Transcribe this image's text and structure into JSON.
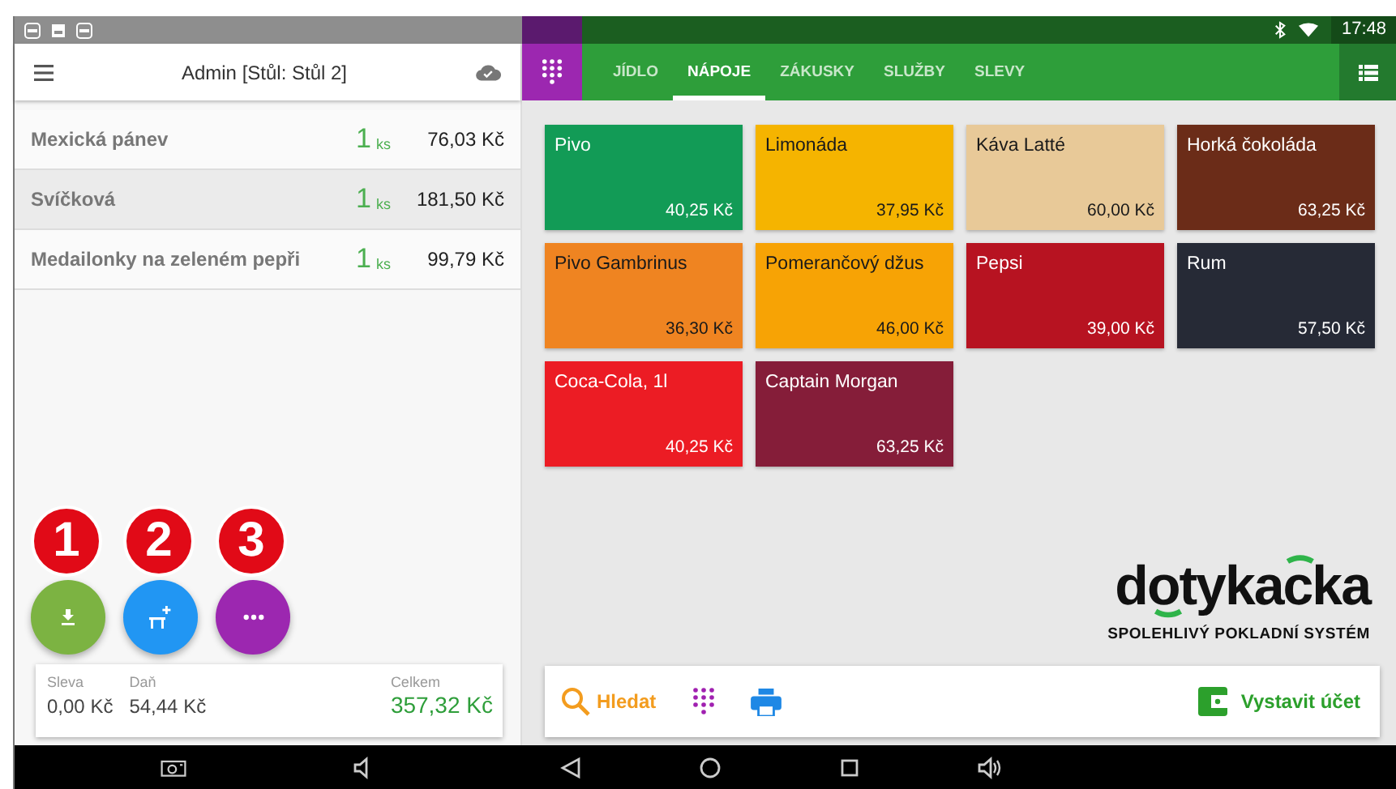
{
  "status_bar": {
    "time": "17:48"
  },
  "header": {
    "title": "Admin [Stůl: Stůl 2]"
  },
  "order_items": [
    {
      "name": "Mexická pánev",
      "quantity": "1",
      "unit": "ks",
      "price": "76,03 Kč",
      "selected": false
    },
    {
      "name": "Svíčková",
      "quantity": "1",
      "unit": "ks",
      "price": "181,50 Kč",
      "selected": true
    },
    {
      "name": "Medailonky na zeleném pepři",
      "quantity": "1",
      "unit": "ks",
      "price": "99,79 Kč",
      "selected": false
    }
  ],
  "action_buttons": [
    {
      "kind": "download",
      "badge": "1",
      "color": "#7cb342"
    },
    {
      "kind": "add-table",
      "badge": "2",
      "color": "#2196f3"
    },
    {
      "kind": "more",
      "badge": "3",
      "color": "#9c27b0"
    }
  ],
  "totals": {
    "discount_label": "Sleva",
    "discount": "0,00 Kč",
    "tax_label": "Daň",
    "tax": "54,44 Kč",
    "total_label": "Celkem",
    "total": "357,32 Kč"
  },
  "tabs": [
    {
      "label": "JÍDLO",
      "selected": false
    },
    {
      "label": "NÁPOJE",
      "selected": true
    },
    {
      "label": "ZÁKUSKY",
      "selected": false
    },
    {
      "label": "SLUŽBY",
      "selected": false
    },
    {
      "label": "SLEVY",
      "selected": false
    }
  ],
  "products": [
    {
      "name": "Pivo",
      "price": "40,25 Kč",
      "color": "#129b56",
      "kind": "light"
    },
    {
      "name": "Limonáda",
      "price": "37,95 Kč",
      "color": "#f5b400",
      "kind": "dark"
    },
    {
      "name": "Káva Latté",
      "price": "60,00 Kč",
      "color": "#e8c998",
      "kind": "dark"
    },
    {
      "name": "Horká čokoláda",
      "price": "63,25 Kč",
      "color": "#6b2c18",
      "kind": "light"
    },
    {
      "name": "Pivo Gambrinus",
      "price": "36,30 Kč",
      "color": "#ef8421",
      "kind": "dark"
    },
    {
      "name": "Pomerančový džus",
      "price": "46,00 Kč",
      "color": "#f7a305",
      "kind": "dark"
    },
    {
      "name": "Pepsi",
      "price": "39,00 Kč",
      "color": "#b71321",
      "kind": "light"
    },
    {
      "name": "Rum",
      "price": "57,50 Kč",
      "color": "#262a36",
      "kind": "light"
    },
    {
      "name": "Coca-Cola, 1l",
      "price": "40,25 Kč",
      "color": "#ec1c24",
      "kind": "light"
    },
    {
      "name": "Captain Morgan",
      "price": "63,25 Kč",
      "color": "#851d39",
      "kind": "light"
    }
  ],
  "logo": {
    "wordmark": "dotykacka",
    "tagline": "SPOLEHLIVÝ POKLADNÍ SYSTÉM"
  },
  "toolbar": {
    "search_label": "Hledat",
    "invoice_label": "Vystavit účet"
  }
}
